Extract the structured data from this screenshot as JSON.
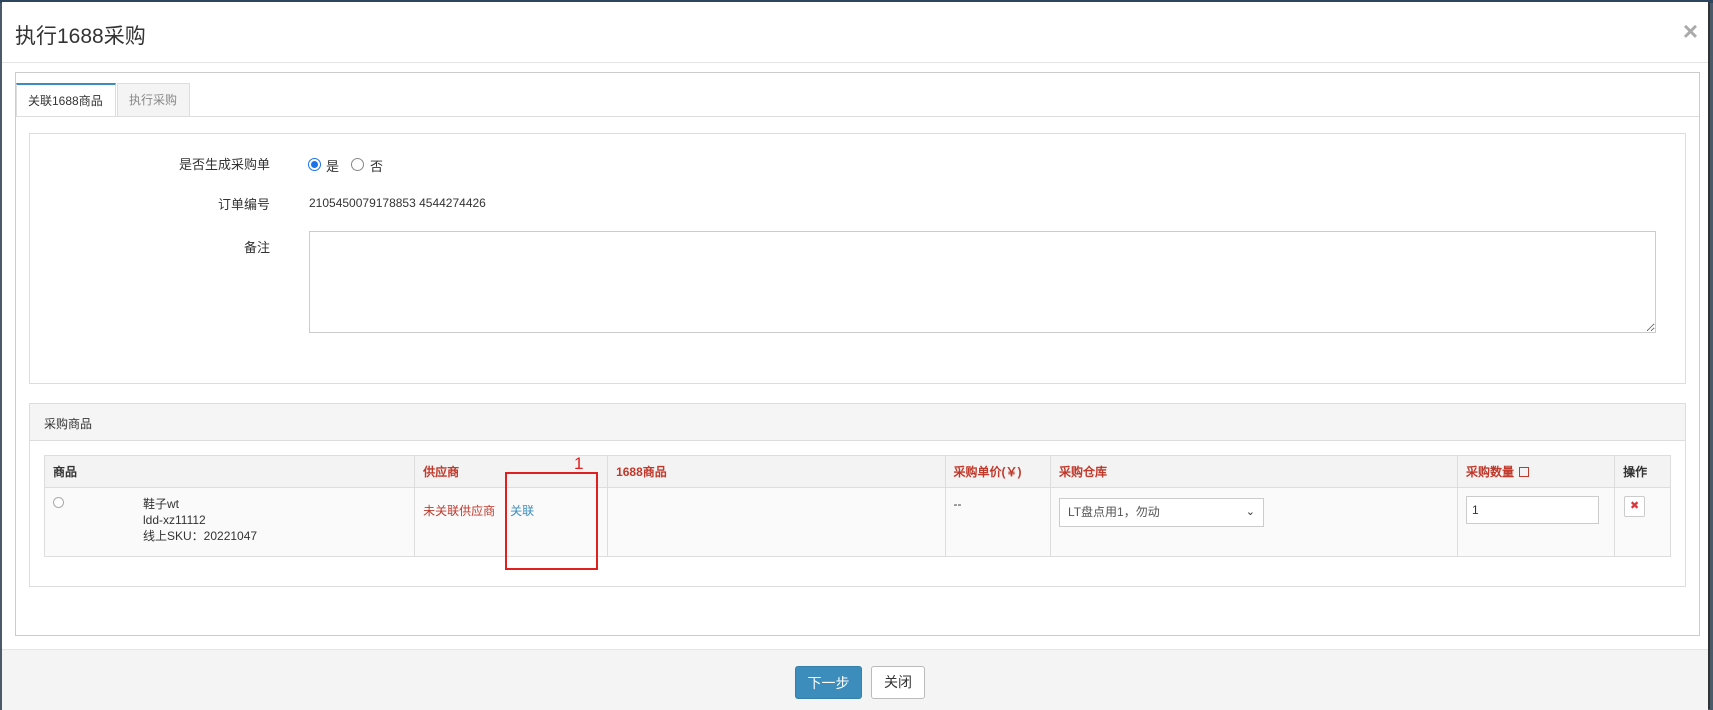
{
  "modal": {
    "title": "执行1688采购"
  },
  "tabs": [
    {
      "label": "关联1688商品",
      "active": true
    },
    {
      "label": "执行采购",
      "active": false
    }
  ],
  "form": {
    "generate_po_label": "是否生成采购单",
    "radio_yes": "是",
    "radio_no": "否",
    "selected": "是",
    "order_no_label": "订单编号",
    "order_no_value": "2105450079178853 4544274426",
    "remark_label": "备注",
    "remark_value": ""
  },
  "goods": {
    "panel_title": "采购商品",
    "columns": [
      "商品",
      "供应商",
      "1688商品",
      "采购单价(￥)",
      "采购仓库",
      "采购数量",
      "操作"
    ],
    "rows": [
      {
        "product_name": "鞋子wt",
        "product_code": "ldd-xz11112",
        "online_sku": "线上SKU：20221047",
        "supplier_status": "未关联供应商",
        "link_label": "关联",
        "product_1688": "",
        "unit_price": "--",
        "warehouse": "LT盘点用1，勿动",
        "quantity": "1"
      }
    ]
  },
  "annotation": {
    "number": "1"
  },
  "footer": {
    "next_label": "下一步",
    "close_label": "关闭"
  },
  "colors": {
    "primary": "#3c8dbc",
    "required_red": "#c0392b",
    "annotation_red": "#e02020"
  }
}
